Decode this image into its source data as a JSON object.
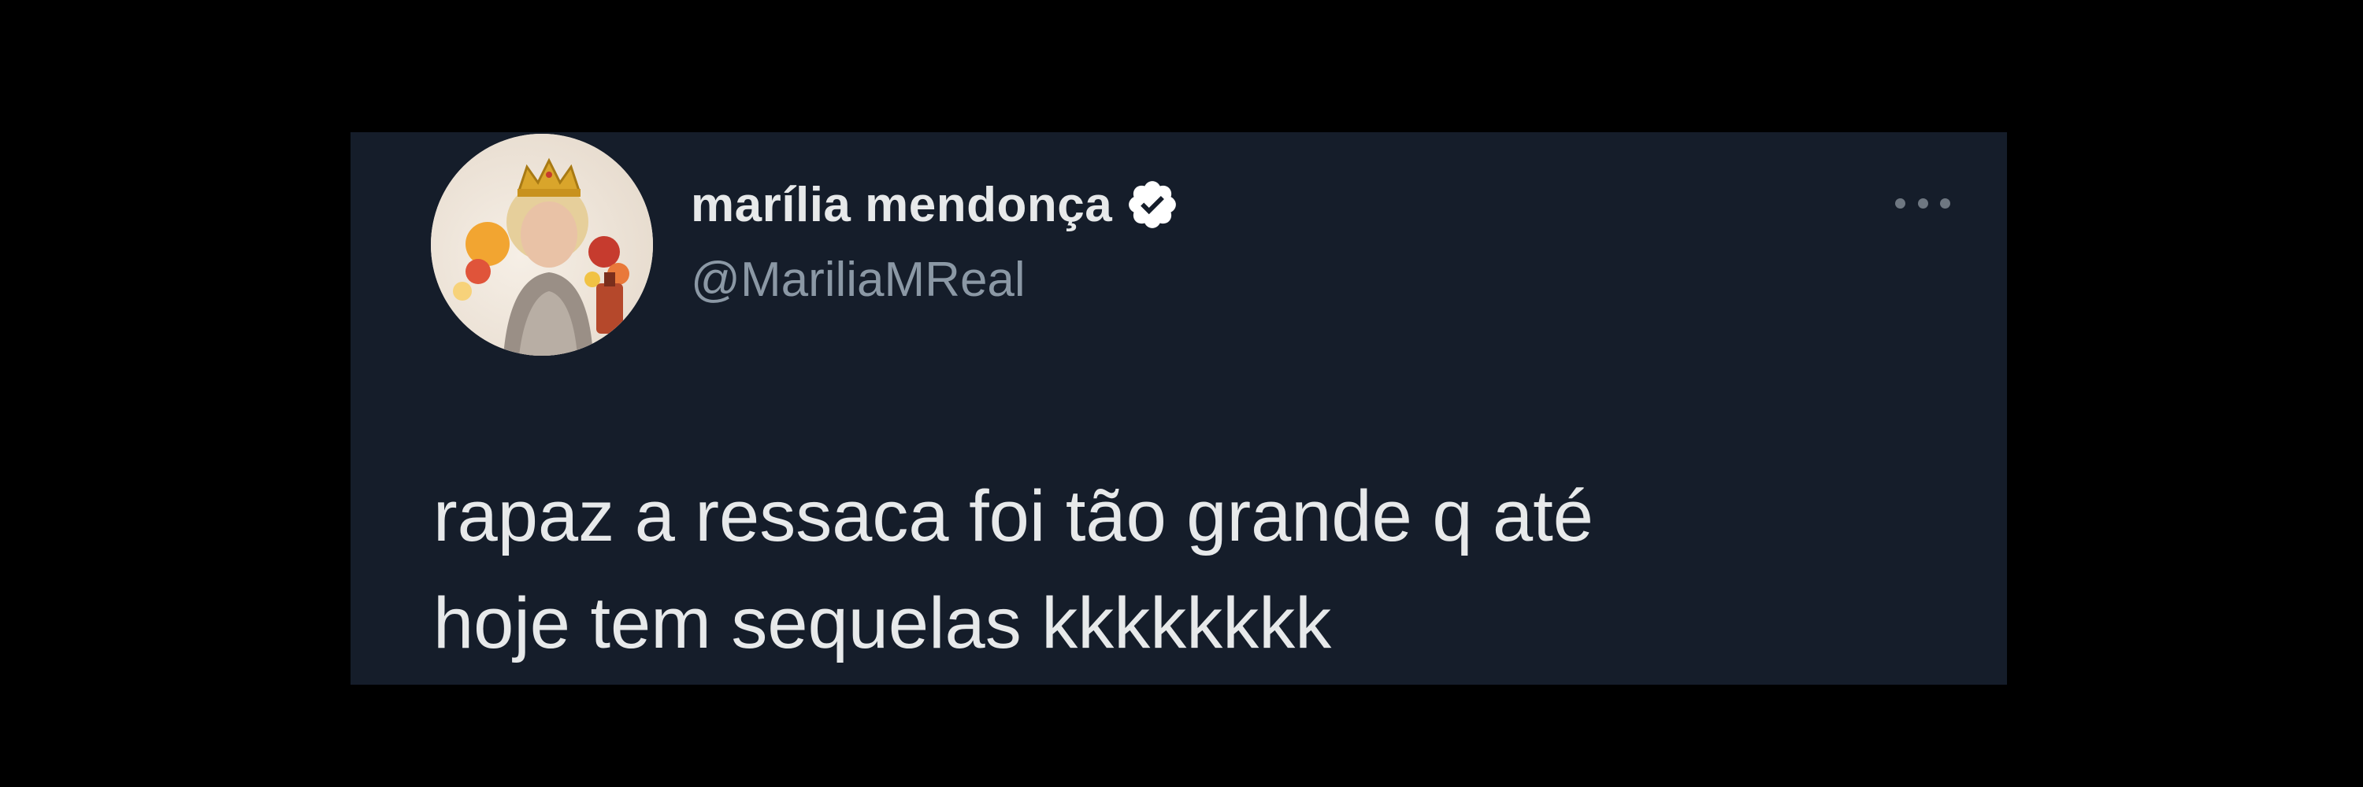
{
  "tweet": {
    "author": {
      "display_name": "marília mendonça",
      "handle": "@MariliaMReal",
      "verified": true,
      "avatar_icon": "avatar-photo"
    },
    "more_icon": "more-options-icon",
    "text_lines": [
      "rapaz a ressaca foi tão grande q até",
      "hoje tem sequelas kkkkkkkk"
    ]
  },
  "colors": {
    "page_background": "#000000",
    "card_background": "#151d2a",
    "primary_text": "#e7e9ea",
    "secondary_text": "#8b98a5",
    "verified_badge": "#ffffff"
  }
}
